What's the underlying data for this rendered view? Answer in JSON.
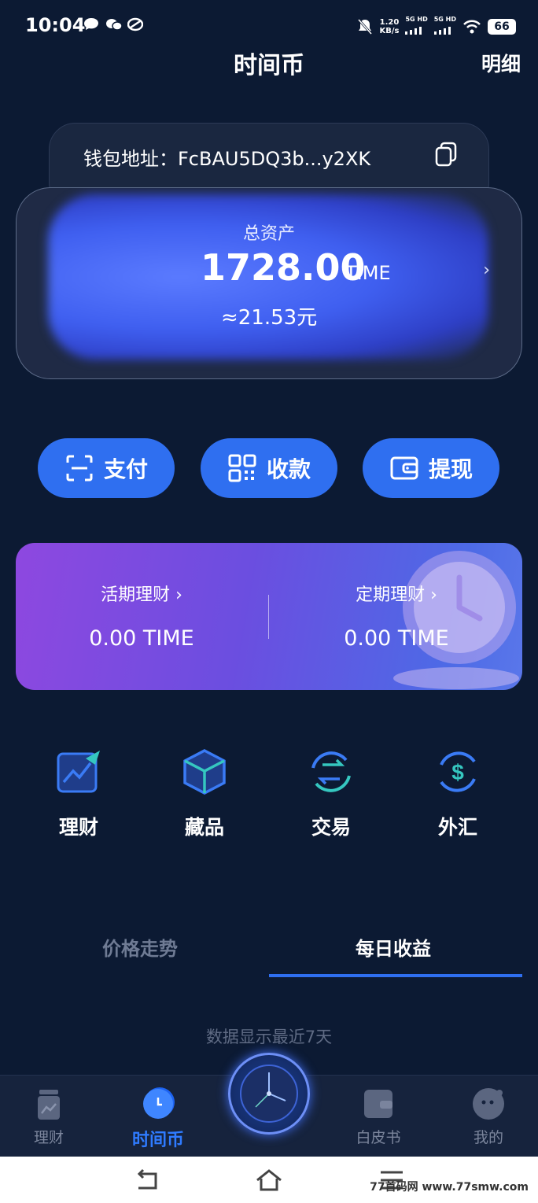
{
  "status_bar": {
    "time": "10:04",
    "net_speed": "1.20",
    "net_speed_unit": "KB/s",
    "sim1": "5G HD",
    "sim2": "5G HD",
    "battery": "66"
  },
  "header": {
    "title": "时间币",
    "detail_link": "明细"
  },
  "wallet": {
    "address_label": "钱包地址：FcBAU5DQ3b...y2XK"
  },
  "asset": {
    "title": "总资产",
    "amount": "1728.00",
    "unit": "TIME",
    "cny": "≈21.53元",
    "arrow": "›"
  },
  "actions": [
    {
      "label": "支付",
      "icon": "scan-icon"
    },
    {
      "label": "收款",
      "icon": "qrcode-icon"
    },
    {
      "label": "提现",
      "icon": "wallet-icon"
    }
  ],
  "finance": {
    "current_label": "活期理财 ›",
    "current_value": "0.00 TIME",
    "fixed_label": "定期理财 ›",
    "fixed_value": "0.00 TIME"
  },
  "shortcuts": [
    {
      "label": "理财",
      "icon": "chart-up-icon"
    },
    {
      "label": "藏品",
      "icon": "cube-icon"
    },
    {
      "label": "交易",
      "icon": "exchange-icon"
    },
    {
      "label": "外汇",
      "icon": "dollar-icon"
    }
  ],
  "tabs": {
    "price_trend": "价格走势",
    "daily_income": "每日收益"
  },
  "hint": "数据显示最近7天",
  "bottom_nav": {
    "items": [
      {
        "label": "理财",
        "icon": "jar-icon"
      },
      {
        "label": "时间币",
        "icon": "clock-coin-icon"
      },
      {
        "label": "白皮书",
        "icon": "book-icon"
      },
      {
        "label": "我的",
        "icon": "profile-icon"
      }
    ]
  },
  "watermark": "77首码网 www.77smw.com",
  "colors": {
    "accent": "#2f6ff0",
    "background": "#0c1a33"
  }
}
